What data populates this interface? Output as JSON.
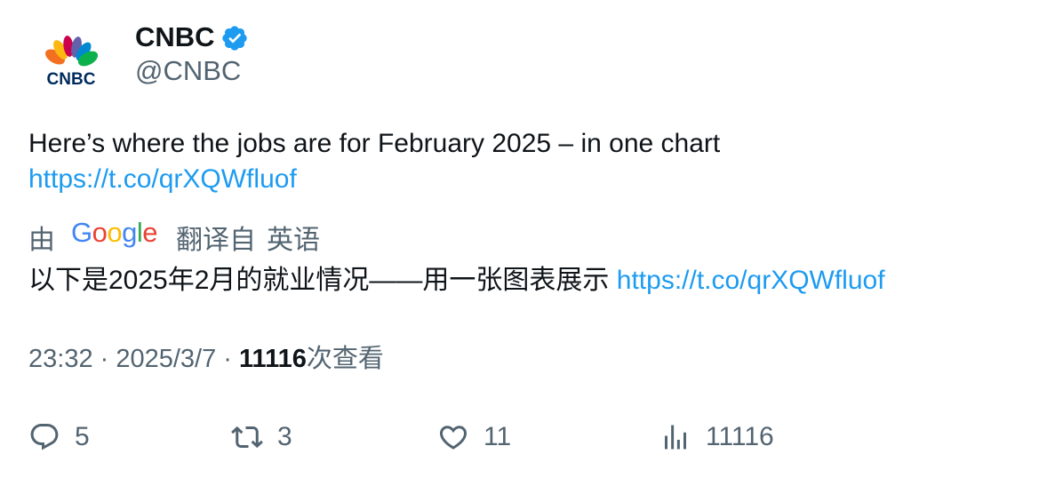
{
  "author": {
    "name": "CNBC",
    "handle": "@CNBC",
    "avatar_text": "CNBC",
    "verified_color": "#1d9bf0"
  },
  "tweet": {
    "text": "Here’s where the jobs are for February 2025 – in one chart",
    "link": "https://t.co/qrXQWfluof"
  },
  "translation": {
    "by": "由",
    "provider": "Google",
    "translated_from": "翻译自",
    "language": "英语",
    "text": "以下是2025年2月的就业情况——用一张图表展示",
    "link": "https://t.co/qrXQWfluof"
  },
  "meta": {
    "time": "23:32",
    "sep1": " · ",
    "date": "2025/3/7",
    "sep2": " · ",
    "views": "11116",
    "views_label": "次查看"
  },
  "actions": {
    "replies": "5",
    "retweets": "3",
    "likes": "11",
    "views": "11116"
  },
  "colors": {
    "link": "#1d9bf0",
    "secondary_text": "#536471",
    "primary_text": "#0f1419"
  }
}
